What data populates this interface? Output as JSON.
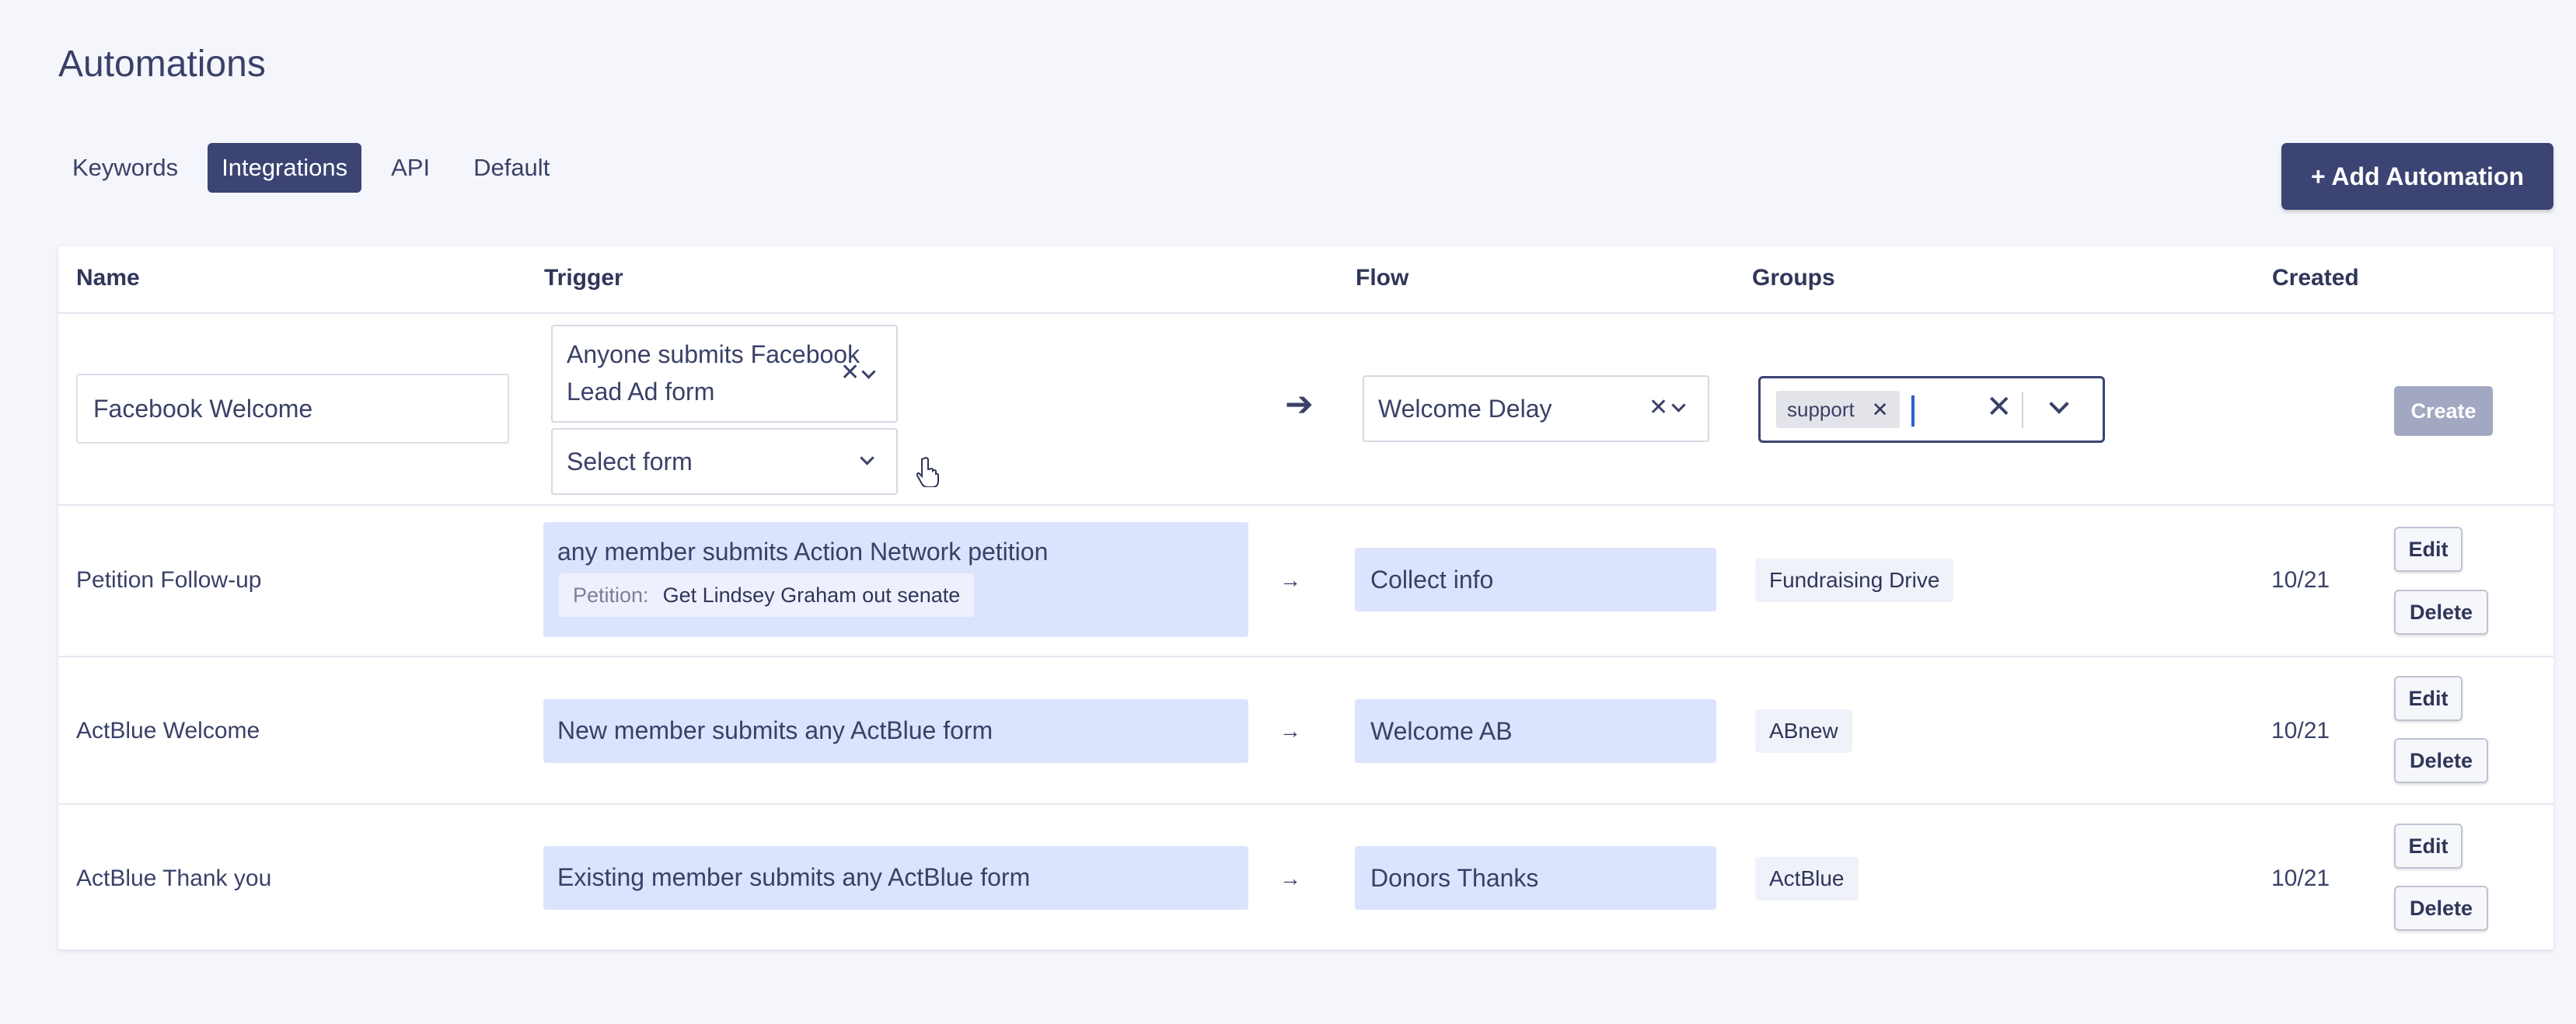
{
  "page": {
    "title": "Automations"
  },
  "tabs": [
    {
      "label": "Keywords",
      "active": false
    },
    {
      "label": "Integrations",
      "active": true
    },
    {
      "label": "API",
      "active": false
    },
    {
      "label": "Default",
      "active": false
    }
  ],
  "add_button": {
    "label": "+ Add Automation"
  },
  "table": {
    "headers": [
      "Name",
      "Trigger",
      "Flow",
      "Groups",
      "Created"
    ],
    "new_row": {
      "name_value": "Facebook Welcome",
      "trigger_value": "Anyone submits Facebook Lead Ad form",
      "form_placeholder": "Select form",
      "flow_value": "Welcome Delay",
      "group_tag": "support",
      "create_label": "Create"
    },
    "rows": [
      {
        "name": "Petition Follow-up",
        "trigger": "any member submits Action Network petition",
        "petition_label": "Petition:",
        "petition_value": "Get Lindsey Graham out senate",
        "flow": "Collect info",
        "group": "Fundraising Drive",
        "created": "10/21",
        "edit_label": "Edit",
        "delete_label": "Delete"
      },
      {
        "name": "ActBlue Welcome",
        "trigger": "New member submits any ActBlue form",
        "flow": "Welcome AB",
        "group": "ABnew",
        "created": "10/21",
        "edit_label": "Edit",
        "delete_label": "Delete"
      },
      {
        "name": "ActBlue Thank you",
        "trigger": "Existing member submits any ActBlue form",
        "flow": "Donors Thanks",
        "group": "ActBlue",
        "created": "10/21",
        "edit_label": "Edit",
        "delete_label": "Delete"
      }
    ]
  },
  "icons": {
    "clear": "close-icon",
    "dropdown": "chevron-down-icon",
    "arrow": "arrow-right-icon",
    "cursor": "hand-pointer-icon"
  },
  "colors": {
    "accent": "#3b4473",
    "highlight": "#dce3fc",
    "background": "#f5f6fb",
    "create_disabled": "#a3a8c2"
  }
}
